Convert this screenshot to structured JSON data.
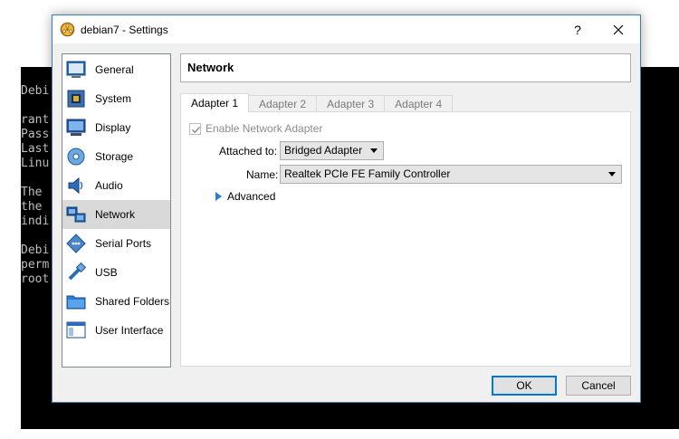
{
  "terminal": {
    "lines": [
      "Debi",
      "",
      "rant",
      "Pass",
      "Last",
      "Linu",
      "",
      "The",
      "the",
      "indi",
      "",
      "Debi",
      "perm",
      "root"
    ]
  },
  "window": {
    "title": "debian7 - Settings",
    "help_label": "?",
    "icon": "gear-icon",
    "close_icon": "close-icon"
  },
  "sidebar": {
    "selected": "Network",
    "items": [
      {
        "label": "General",
        "icon": "general-icon"
      },
      {
        "label": "System",
        "icon": "chip-icon"
      },
      {
        "label": "Display",
        "icon": "monitor-icon"
      },
      {
        "label": "Storage",
        "icon": "disk-icon"
      },
      {
        "label": "Audio",
        "icon": "speaker-icon"
      },
      {
        "label": "Network",
        "icon": "network-icon"
      },
      {
        "label": "Serial Ports",
        "icon": "serial-port-icon"
      },
      {
        "label": "USB",
        "icon": "usb-icon"
      },
      {
        "label": "Shared Folders",
        "icon": "folder-icon"
      },
      {
        "label": "User Interface",
        "icon": "window-icon"
      }
    ]
  },
  "main": {
    "section_title": "Network",
    "tabs": [
      {
        "label": "Adapter 1",
        "active": true
      },
      {
        "label": "Adapter 2",
        "active": false
      },
      {
        "label": "Adapter 3",
        "active": false
      },
      {
        "label": "Adapter 4",
        "active": false
      }
    ],
    "enable_adapter": {
      "label": "Enable Network Adapter",
      "checked": true,
      "disabled": true
    },
    "attached_to": {
      "label": "Attached to:",
      "value": "Bridged Adapter"
    },
    "name": {
      "label": "Name:",
      "value": "Realtek PCIe FE Family Controller"
    },
    "advanced": {
      "label": "Advanced",
      "expanded": false
    }
  },
  "buttons": {
    "ok_label": "OK",
    "cancel_label": "Cancel"
  },
  "colors": {
    "accent": "#0078d7",
    "window_border": "#3c7fb1",
    "selected_item": "#d9d9d9",
    "expander": "#2f7bd3"
  }
}
